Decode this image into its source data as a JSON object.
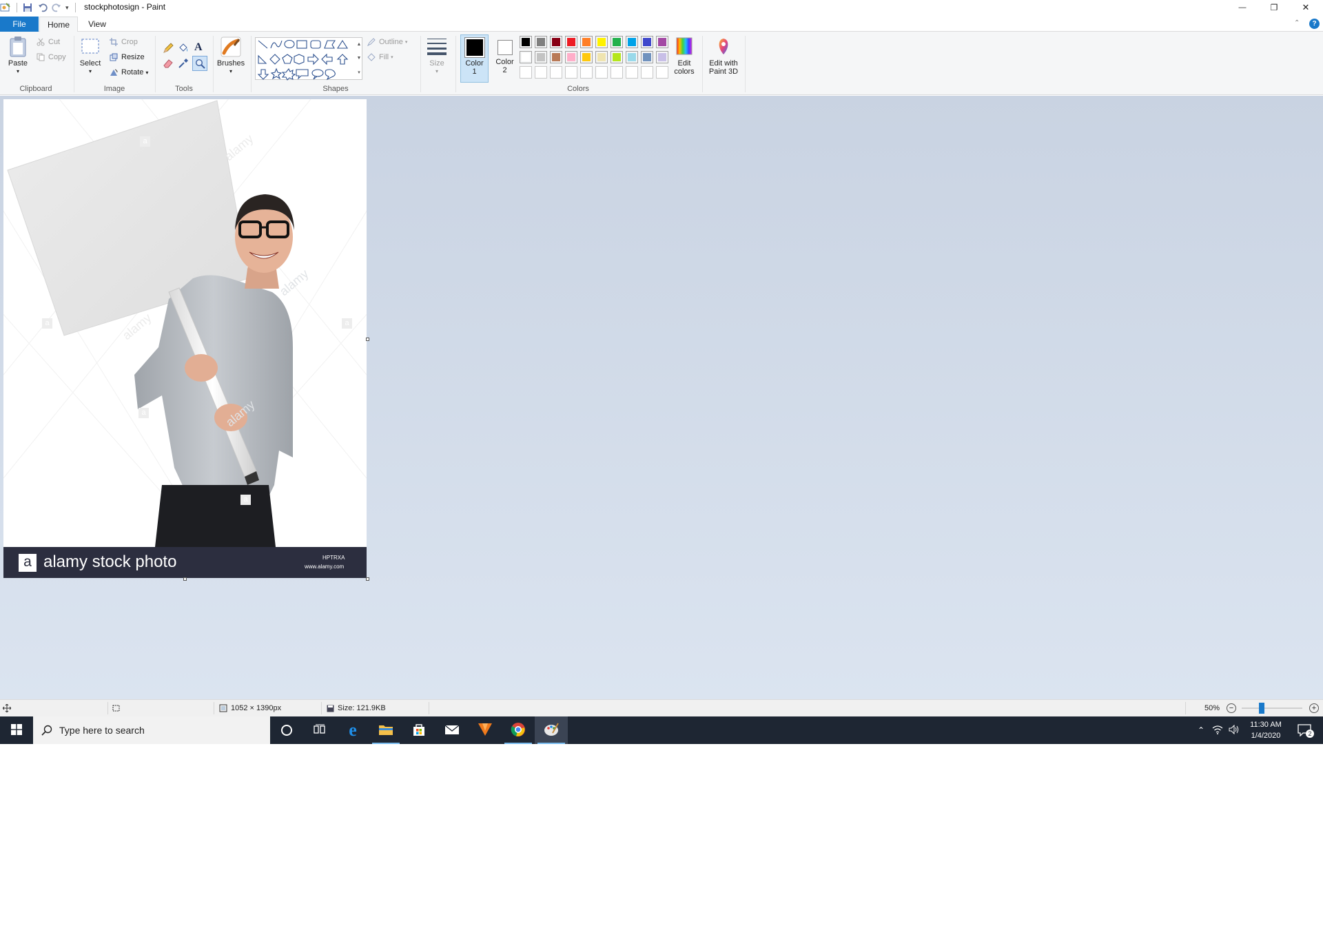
{
  "window": {
    "title": "stockphotosign - Paint",
    "minimize_glyph": "—",
    "restore_glyph": "❐",
    "close_glyph": "✕"
  },
  "tabs": {
    "file": "File",
    "home": "Home",
    "view": "View"
  },
  "ribbon": {
    "clipboard": {
      "label": "Clipboard",
      "paste": "Paste",
      "cut": "Cut",
      "copy": "Copy"
    },
    "image": {
      "label": "Image",
      "select": "Select",
      "crop": "Crop",
      "resize": "Resize",
      "rotate": "Rotate"
    },
    "tools": {
      "label": "Tools"
    },
    "brushes": {
      "label": "Brushes"
    },
    "shapes": {
      "label": "Shapes",
      "outline": "Outline",
      "fill": "Fill"
    },
    "size": {
      "label": "Size"
    },
    "colors": {
      "label": "Colors",
      "color1": "Color",
      "color1_num": "1",
      "color2": "Color",
      "color2_num": "2",
      "edit_colors_line1": "Edit",
      "edit_colors_line2": "colors",
      "color1_value": "#000000",
      "color2_value": "#ffffff",
      "palette_row1": [
        "#000000",
        "#7f7f7f",
        "#880015",
        "#ed1c24",
        "#ff7f27",
        "#fff200",
        "#22b14c",
        "#00a2e8",
        "#3f48cc",
        "#a349a4"
      ],
      "palette_row2": [
        "#ffffff",
        "#c3c3c3",
        "#b97a57",
        "#ffaec9",
        "#ffc90e",
        "#efe4b0",
        "#b5e61d",
        "#99d9ea",
        "#7092be",
        "#c8bfe7"
      ],
      "palette_row3": [
        "#ffffff",
        "#ffffff",
        "#ffffff",
        "#ffffff",
        "#ffffff",
        "#ffffff",
        "#ffffff",
        "#ffffff",
        "#ffffff",
        "#ffffff"
      ]
    },
    "paint3d": {
      "line1": "Edit with",
      "line2": "Paint 3D"
    }
  },
  "canvas_image": {
    "brand": "alamy stock photo",
    "logo_letter": "a",
    "image_id": "HPTRXA",
    "url": "www.alamy.com",
    "watermark": "alamy"
  },
  "statusbar": {
    "dimensions": "1052 × 1390px",
    "size": "Size: 121.9KB",
    "zoom": "50%",
    "zoom_level": 0.5
  },
  "taskbar": {
    "search_placeholder": "Type here to search",
    "time": "11:30 AM",
    "date": "1/4/2020",
    "notification_count": "2"
  },
  "colors": {
    "accent": "#1979ca",
    "taskbar": "#1e2633",
    "workspace_top": "#c9d3e2",
    "workspace_bottom": "#dbe4f0"
  }
}
